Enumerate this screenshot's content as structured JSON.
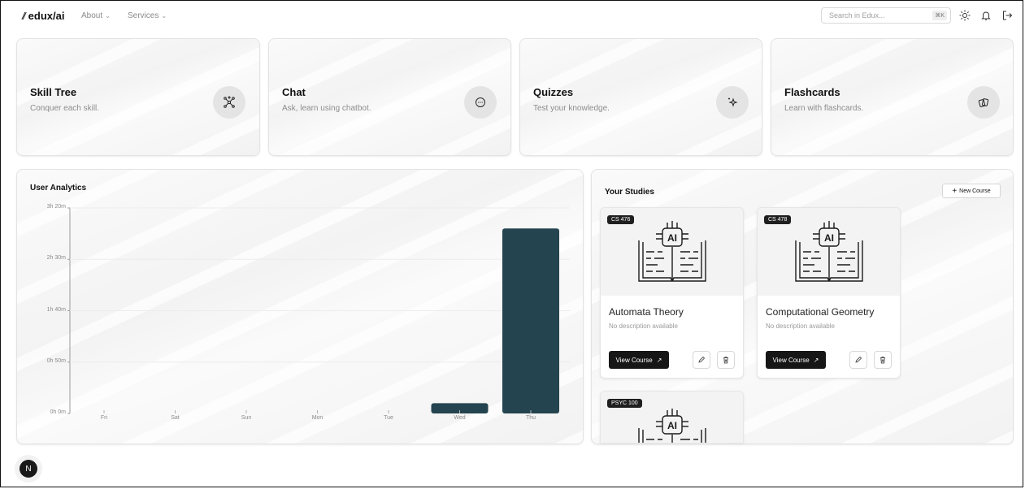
{
  "nav": {
    "logo": "edux/ai",
    "links": [
      {
        "label": "About"
      },
      {
        "label": "Services"
      }
    ],
    "search_placeholder": "Search in Edux...",
    "search_shortcut": "⌘K"
  },
  "features": [
    {
      "title": "Skill Tree",
      "subtitle": "Conquer each skill.",
      "icon": "network-icon"
    },
    {
      "title": "Chat",
      "subtitle": "Ask, learn using chatbot.",
      "icon": "chat-bubble-icon"
    },
    {
      "title": "Quizzes",
      "subtitle": "Test your knowledge.",
      "icon": "sparkle-icon"
    },
    {
      "title": "Flashcards",
      "subtitle": "Learn with flashcards.",
      "icon": "cards-icon"
    }
  ],
  "analytics": {
    "title": "User Analytics"
  },
  "chart_data": {
    "type": "bar",
    "title": "User Analytics",
    "categories": [
      "Fri",
      "Sat",
      "Sun",
      "Mon",
      "Tue",
      "Wed",
      "Thu"
    ],
    "values_minutes": [
      0,
      0,
      0,
      0,
      0,
      10,
      180
    ],
    "ytick_labels": [
      "0h 0m",
      "0h 50m",
      "1h 40m",
      "2h 30m",
      "3h 20m"
    ],
    "ytick_values_minutes": [
      0,
      50,
      100,
      150,
      200
    ],
    "ylim_minutes": [
      0,
      200
    ],
    "bar_color": "#24444f"
  },
  "studies": {
    "title": "Your Studies",
    "new_course_label": "New Course",
    "courses": [
      {
        "code": "CS 476",
        "title": "Automata Theory",
        "description": "No description available",
        "view_label": "View Course"
      },
      {
        "code": "CS 478",
        "title": "Computational Geometry",
        "description": "No description available",
        "view_label": "View Course"
      },
      {
        "code": "PSYC 100",
        "title": "",
        "description": "",
        "view_label": ""
      }
    ]
  },
  "badge": "N",
  "colors": {
    "accent_dark": "#161616",
    "bar": "#24444f"
  }
}
